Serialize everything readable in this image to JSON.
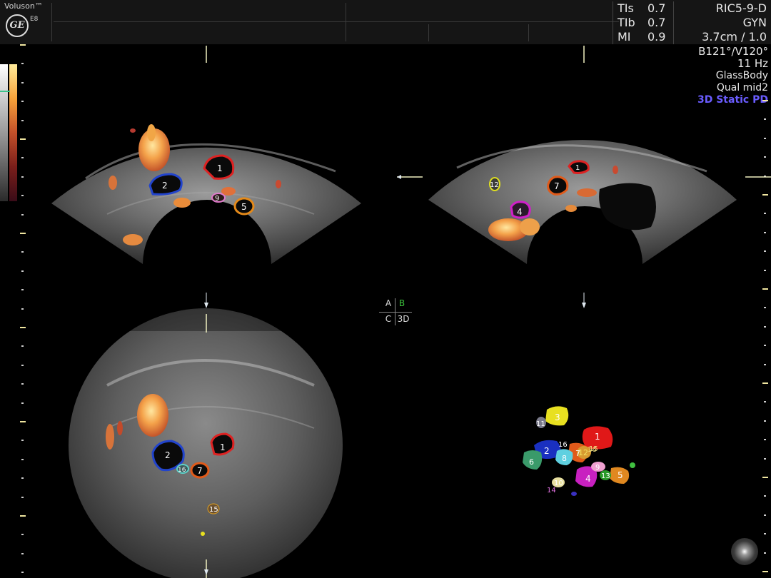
{
  "header": {
    "brand": "Voluson™",
    "logo": "GE",
    "model": "E8",
    "params": [
      {
        "label": "TIs",
        "value": "0.7"
      },
      {
        "label": "TIb",
        "value": "0.7"
      },
      {
        "label": "MI",
        "value": "0.9"
      }
    ],
    "probe": "RIC5-9-D",
    "application": "GYN",
    "depth": "3.7cm / 1.0"
  },
  "right_info": {
    "angle": "B121°/V120°",
    "frame_rate": "11 Hz",
    "render_mode": "GlassBody",
    "quality": "Qual mid2",
    "mode": "3D Static PD"
  },
  "quadrants": {
    "a": "A",
    "b": "B",
    "c": "C",
    "d": "3D"
  },
  "panelA_labels": [
    "1",
    "2",
    "9",
    "5"
  ],
  "panelB_labels": [
    "1",
    "7",
    "12",
    "4"
  ],
  "panelC_labels": [
    "1",
    "2",
    "16",
    "7",
    "15"
  ],
  "volume_labels": [
    "1",
    "2",
    "3",
    "4",
    "5",
    "6",
    "7",
    "8",
    "9",
    "10",
    "11",
    "12",
    "13",
    "14",
    "15",
    "16",
    "16"
  ],
  "colors": {
    "header_bg": "#151515",
    "pd_text": "#6a5cff",
    "quadrant_b": "#3cc33c"
  }
}
